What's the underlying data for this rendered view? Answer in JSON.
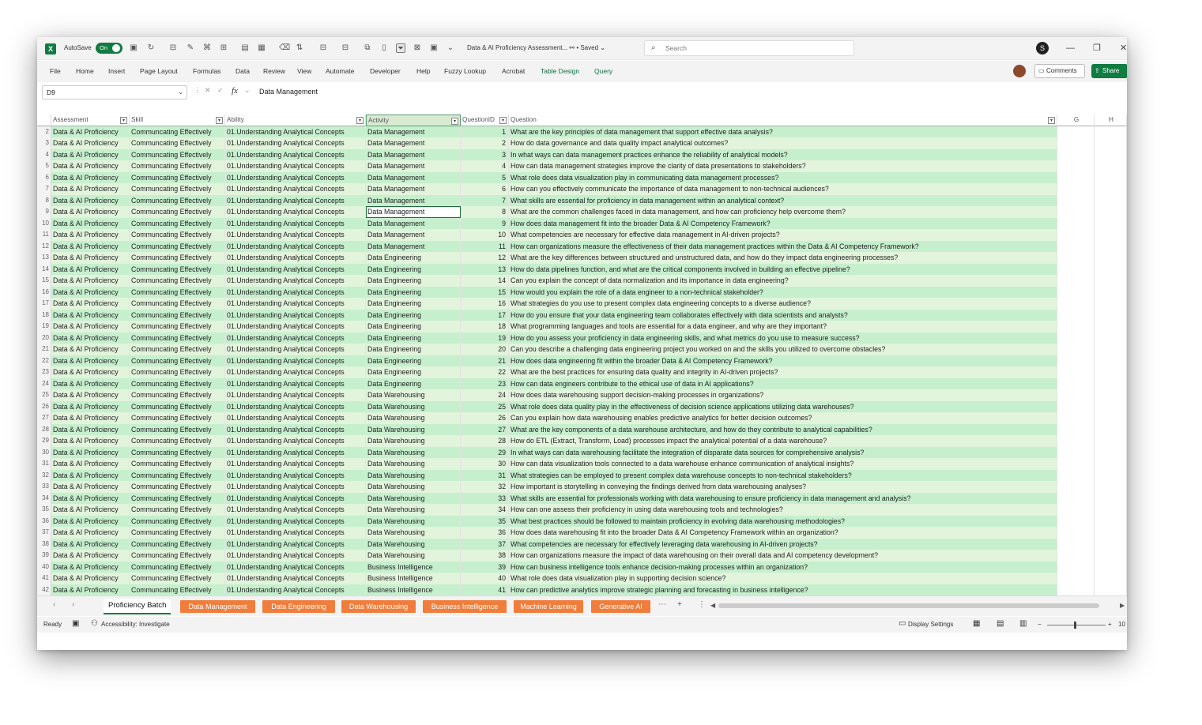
{
  "app": {
    "autosave_label": "AutoSave",
    "toggle_label": "On",
    "doc_title": "Data & AI Proficiency Assessment...  ⚯  • Saved ⌄",
    "search_placeholder": "Search",
    "profile_initial": "S"
  },
  "menu": [
    "File",
    "Home",
    "Insert",
    "Page Layout",
    "Formulas",
    "Data",
    "Review",
    "View",
    "Automate",
    "Developer",
    "Help",
    "Fuzzy Lookup",
    "Acrobat",
    "Table Design",
    "Query"
  ],
  "actions": {
    "comments": "Comments",
    "share": "Share"
  },
  "formula_bar": {
    "cell_ref": "D9",
    "value": "Data Management"
  },
  "columns": {
    "assessment": "Assessment",
    "skill": "Skill",
    "ability": "Ability",
    "activity": "Activity",
    "question_id": "QuestionID",
    "question": "Question",
    "g": "G",
    "h": "H"
  },
  "common": {
    "assessment": "Data & AI Proficiency",
    "skill": "Communcating Effectively",
    "ability": "01.Understanding Analytical Concepts"
  },
  "rows": [
    {
      "n": "2",
      "act": "Data Management",
      "id": "1",
      "q": "What are the key principles of data management that support effective data analysis?"
    },
    {
      "n": "3",
      "act": "Data Management",
      "id": "2",
      "q": "How do data governance and data quality impact analytical outcomes?"
    },
    {
      "n": "4",
      "act": "Data Management",
      "id": "3",
      "q": "In what ways can data management practices enhance the reliability of analytical models?"
    },
    {
      "n": "5",
      "act": "Data Management",
      "id": "4",
      "q": "How can data management strategies improve the clarity of data presentations to stakeholders?"
    },
    {
      "n": "6",
      "act": "Data Management",
      "id": "5",
      "q": "What role does data visualization play in communicating data management processes?"
    },
    {
      "n": "7",
      "act": "Data Management",
      "id": "6",
      "q": "How can you effectively communicate the importance of data management to non-technical audiences?"
    },
    {
      "n": "8",
      "act": "Data Management",
      "id": "7",
      "q": "What skills are essential for proficiency in data management within an analytical context?"
    },
    {
      "n": "9",
      "act": "Data Management",
      "id": "8",
      "q": "What are the common challenges faced in data management, and how can proficiency help overcome them?"
    },
    {
      "n": "10",
      "act": "Data Management",
      "id": "9",
      "q": "How does data management fit into the broader Data & AI Competency Framework?"
    },
    {
      "n": "11",
      "act": "Data Management",
      "id": "10",
      "q": "What competencies are necessary for effective data management in AI-driven projects?"
    },
    {
      "n": "12",
      "act": "Data Management",
      "id": "11",
      "q": "How can organizations measure the effectiveness of their data management practices within the Data & AI Competency Framework?"
    },
    {
      "n": "13",
      "act": "Data Engineering",
      "id": "12",
      "q": "What are the key differences between structured and unstructured data, and how do they impact data engineering processes?"
    },
    {
      "n": "14",
      "act": "Data Engineering",
      "id": "13",
      "q": "How do data pipelines function, and what are the critical components involved in building an effective pipeline?"
    },
    {
      "n": "15",
      "act": "Data Engineering",
      "id": "14",
      "q": "Can you explain the concept of data normalization and its importance in data engineering?"
    },
    {
      "n": "16",
      "act": "Data Engineering",
      "id": "15",
      "q": "How would you explain the role of a data engineer to a non-technical stakeholder?"
    },
    {
      "n": "17",
      "act": "Data Engineering",
      "id": "16",
      "q": "What strategies do you use to present complex data engineering concepts to a diverse audience?"
    },
    {
      "n": "18",
      "act": "Data Engineering",
      "id": "17",
      "q": "How do you ensure that your data engineering team collaborates effectively with data scientists and analysts?"
    },
    {
      "n": "19",
      "act": "Data Engineering",
      "id": "18",
      "q": "What programming languages and tools are essential for a data engineer, and why are they important?"
    },
    {
      "n": "20",
      "act": "Data Engineering",
      "id": "19",
      "q": "How do you assess your proficiency in data engineering skills, and what metrics do you use to measure success?"
    },
    {
      "n": "21",
      "act": "Data Engineering",
      "id": "20",
      "q": "Can you describe a challenging data engineering project you worked on and the skills you utilized to overcome obstacles?"
    },
    {
      "n": "22",
      "act": "Data Engineering",
      "id": "21",
      "q": "How does data engineering fit within the broader Data & AI Competency Framework?"
    },
    {
      "n": "23",
      "act": "Data Engineering",
      "id": "22",
      "q": "What are the best practices for ensuring data quality and integrity in AI-driven projects?"
    },
    {
      "n": "24",
      "act": "Data Engineering",
      "id": "23",
      "q": "How can data engineers contribute to the ethical use of data in AI applications?"
    },
    {
      "n": "25",
      "act": "Data Warehousing",
      "id": "24",
      "q": "How does data warehousing support decision-making processes in organizations?"
    },
    {
      "n": "26",
      "act": "Data Warehousing",
      "id": "25",
      "q": "What role does data quality play in the effectiveness of decision science applications utilizing data warehouses?"
    },
    {
      "n": "27",
      "act": "Data Warehousing",
      "id": "26",
      "q": "Can you explain how data warehousing enables predictive analytics for better decision outcomes?"
    },
    {
      "n": "28",
      "act": "Data Warehousing",
      "id": "27",
      "q": "What are the key components of a data warehouse architecture, and how do they contribute to analytical capabilities?"
    },
    {
      "n": "29",
      "act": "Data Warehousing",
      "id": "28",
      "q": "How do ETL (Extract, Transform, Load) processes impact the analytical potential of a data warehouse?"
    },
    {
      "n": "30",
      "act": "Data Warehousing",
      "id": "29",
      "q": "In what ways can data warehousing facilitate the integration of disparate data sources for comprehensive analysis?"
    },
    {
      "n": "31",
      "act": "Data Warehousing",
      "id": "30",
      "q": "How can data visualization tools connected to a data warehouse enhance communication of analytical insights?"
    },
    {
      "n": "32",
      "act": "Data Warehousing",
      "id": "31",
      "q": "What strategies can be employed to present complex data warehouse concepts to non-technical stakeholders?"
    },
    {
      "n": "33",
      "act": "Data Warehousing",
      "id": "32",
      "q": "How important is storytelling in conveying the findings derived from data warehousing analyses?"
    },
    {
      "n": "34",
      "act": "Data Warehousing",
      "id": "33",
      "q": "What skills are essential for professionals working with data warehousing to ensure proficiency in data management and analysis?"
    },
    {
      "n": "35",
      "act": "Data Warehousing",
      "id": "34",
      "q": "How can one assess their proficiency in using data warehousing tools and technologies?"
    },
    {
      "n": "36",
      "act": "Data Warehousing",
      "id": "35",
      "q": "What best practices should be followed to maintain proficiency in evolving data warehousing methodologies?"
    },
    {
      "n": "37",
      "act": "Data Warehousing",
      "id": "36",
      "q": "How does data warehousing fit into the broader Data & AI Competency Framework within an organization?"
    },
    {
      "n": "38",
      "act": "Data Warehousing",
      "id": "37",
      "q": "What competencies are necessary for effectively leveraging data warehousing in AI-driven projects?"
    },
    {
      "n": "39",
      "act": "Data Warehousing",
      "id": "38",
      "q": "How can organizations measure the impact of data warehousing on their overall data and AI competency development?"
    },
    {
      "n": "40",
      "act": "Business Intelligence",
      "id": "39",
      "q": "How can business intelligence tools enhance decision-making processes within an organization?"
    },
    {
      "n": "41",
      "act": "Business Intelligence",
      "id": "40",
      "q": "What role does data visualization play in supporting decision science?"
    },
    {
      "n": "42",
      "act": "Business Intelligence",
      "id": "41",
      "q": "How can predictive analytics improve strategic planning and forecasting in business intelligence?"
    }
  ],
  "sheets": {
    "active": "Proficiency Batch",
    "others": [
      "Data Management",
      "Data Engineering",
      "Data Warehousing",
      "Business Intelligence",
      "Machine Learning",
      "Generative AI"
    ]
  },
  "status": {
    "ready": "Ready",
    "accessibility": "Accessibility: Investigate",
    "display_settings": "Display Settings",
    "zoom": "10"
  },
  "colors": {
    "brand": "#107c41",
    "row_fill": "#c6efce",
    "tab_orange": "#f07d3c"
  }
}
